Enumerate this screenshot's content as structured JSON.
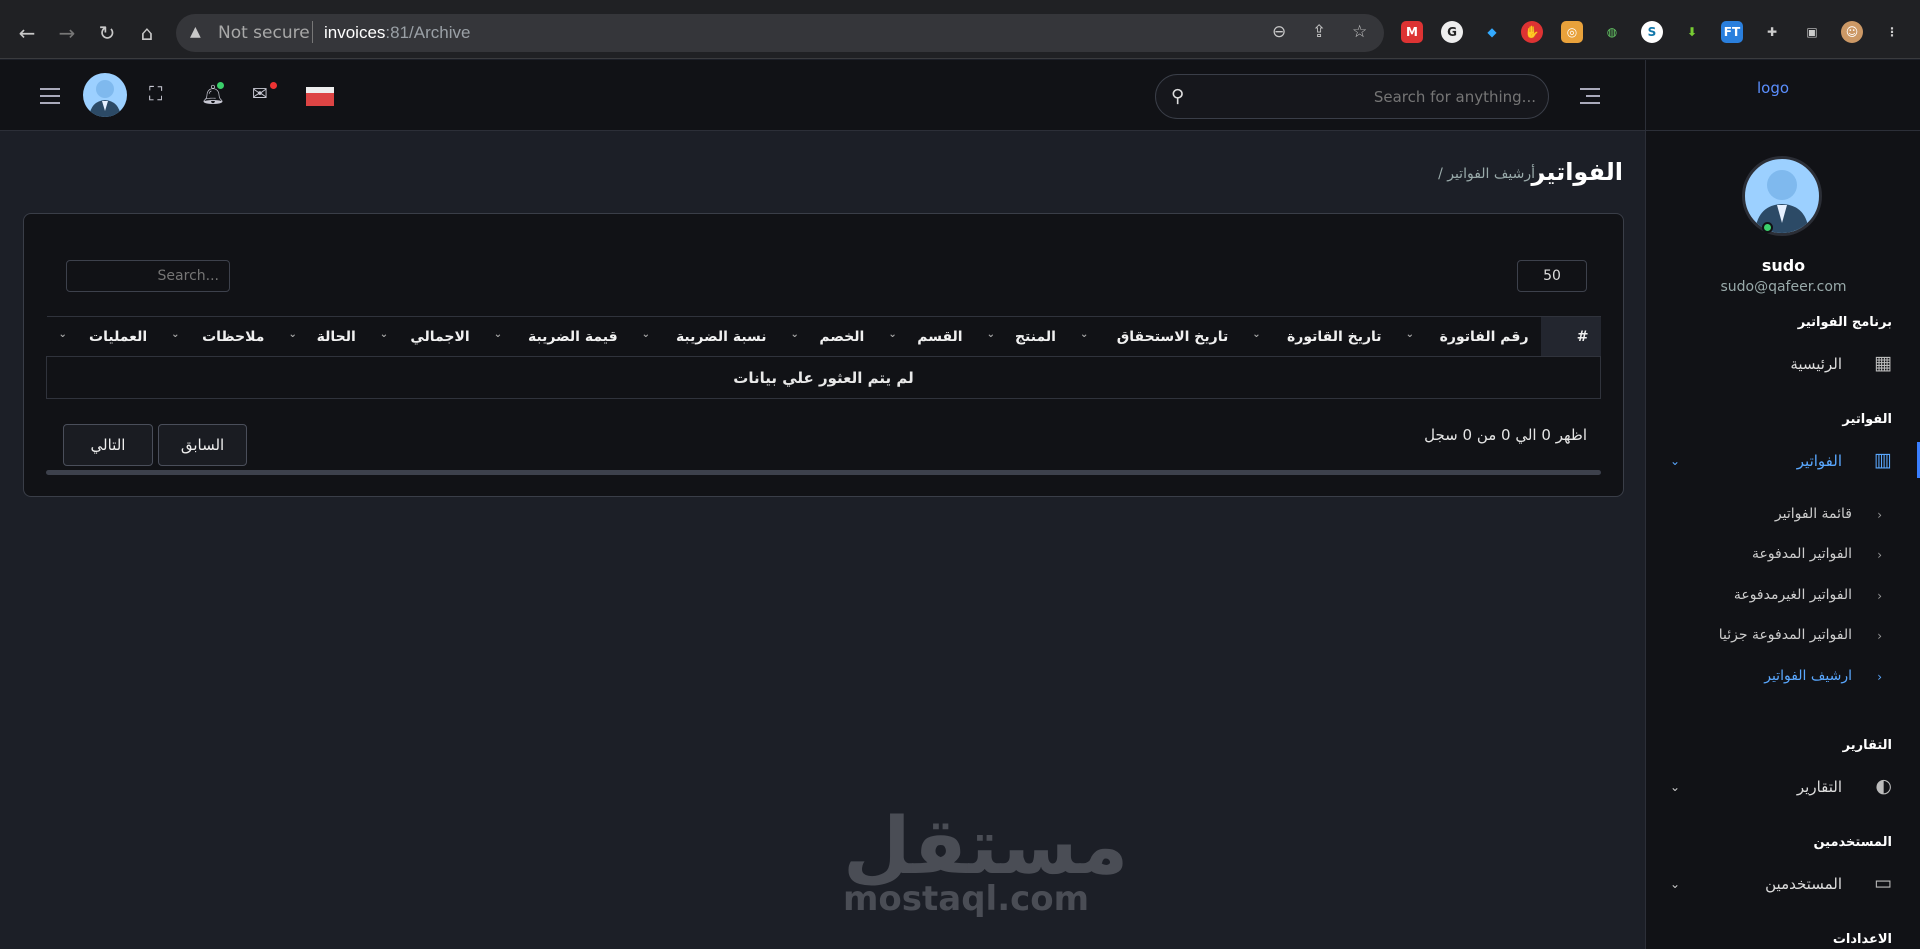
{
  "browser": {
    "not_secure": "Not secure",
    "url_host": "invoices",
    "url_rest": ":81/Archive"
  },
  "topbar": {
    "search_placeholder": "Search for anything..."
  },
  "sidebar": {
    "logo": "logo",
    "user_name": "sudo",
    "user_email": "sudo@qafeer.com",
    "sections": {
      "program": "برنامج الفواتير",
      "invoices": "الفواتير",
      "reports": "التقارير",
      "users": "المستخدمين",
      "settings": "الاعدادات"
    },
    "items": {
      "home": "الرئيسية",
      "invoices": "الفواتير",
      "reports": "التقارير",
      "users": "المستخدمين"
    },
    "submenu": [
      "قائمة الفواتير",
      "الفواتير المدفوعة",
      "الفواتير الغيرمدفوعة",
      "الفواتير المدفوعة جزئيا",
      "ارشيف الفواتير"
    ]
  },
  "page": {
    "title": "الفواتير",
    "breadcrumb": "/ أرشيف الفواتير"
  },
  "table": {
    "page_length": "50",
    "search_placeholder": "Search...",
    "headers": [
      "#",
      "رقم الفاتورة",
      "تاريخ القاتورة",
      "تاريخ الاستحقاق",
      "المنتج",
      "القسم",
      "الخصم",
      "نسبة الضريبة",
      "قيمة الضريبة",
      "الاجمالي",
      "الحالة",
      "ملاحظات",
      "العمليات"
    ],
    "empty_message": "لم يتم العثور علي بيانات",
    "info": "اظهر 0 الي 0 من 0 سجل",
    "prev": "السابق",
    "next": "التالي"
  },
  "watermark": {
    "arabic": "مستقل",
    "latin": "mostaql.com"
  },
  "colors": {
    "accent": "#5aa8ff",
    "background": "#1c1f27",
    "panel": "#111216"
  }
}
